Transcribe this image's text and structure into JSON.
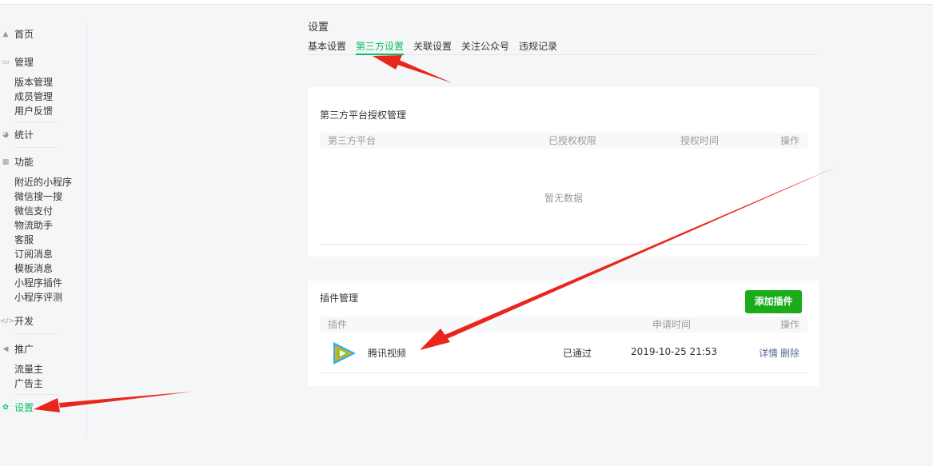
{
  "sidebar": {
    "home": {
      "label": "首页",
      "icon": "home-icon"
    },
    "manage": {
      "label": "管理",
      "icon": "inbox-icon",
      "items": [
        "版本管理",
        "成员管理",
        "用户反馈"
      ]
    },
    "stats": {
      "label": "统计",
      "icon": "pie-icon"
    },
    "features": {
      "label": "功能",
      "icon": "grid-icon",
      "items": [
        "附近的小程序",
        "微信搜一搜",
        "微信支付",
        "物流助手",
        "客服",
        "订阅消息",
        "模板消息",
        "小程序插件",
        "小程序评测"
      ]
    },
    "dev": {
      "label": "开发",
      "icon": "code-icon"
    },
    "promo": {
      "label": "推广",
      "icon": "megaphone-icon",
      "items": [
        "流量主",
        "广告主"
      ]
    },
    "settings": {
      "label": "设置",
      "icon": "gear-icon"
    }
  },
  "page": {
    "title": "设置"
  },
  "tabs": [
    "基本设置",
    "第三方设置",
    "关联设置",
    "关注公众号",
    "违规记录"
  ],
  "auth_card": {
    "title": "第三方平台授权管理",
    "columns": [
      "第三方平台",
      "已授权权限",
      "授权时间",
      "操作"
    ],
    "empty_text": "暂无数据"
  },
  "plugin_card": {
    "title": "插件管理",
    "add_button": "添加插件",
    "columns": [
      "插件",
      "申请时间",
      "操作"
    ],
    "row": {
      "name": "腾讯视频",
      "status": "已通过",
      "time": "2019-10-25 21:53",
      "detail": "详情",
      "delete": "删除"
    }
  },
  "colors": {
    "accent": "#07c160",
    "button": "#1aad19",
    "link": "#576b95",
    "arrow": "#e8261c"
  }
}
